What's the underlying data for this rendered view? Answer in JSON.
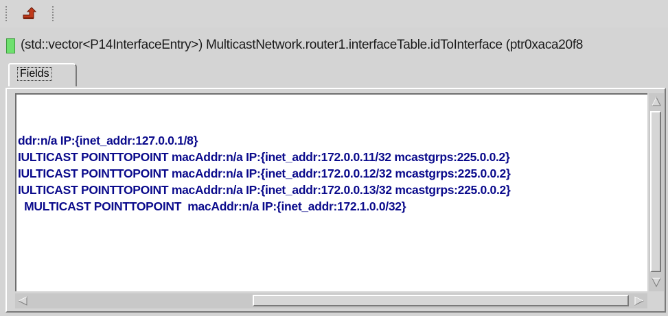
{
  "toolbar": {
    "buttons": [
      {
        "icon": "parent-object-arrow-icon"
      }
    ]
  },
  "infobar": {
    "status_color": "#6ee06e",
    "object_text": "(std::vector<P14InterfaceEntry>) MulticastNetwork.router1.interfaceTable.idToInterface  (ptr0xaca20f8"
  },
  "tabs": [
    {
      "label": "Fields"
    }
  ],
  "content": {
    "lines": [
      "ddr:n/a IP:{inet_addr:127.0.0.1/8}",
      "IULTICAST POINTTOPOINT  macAddr:n/a IP:{inet_addr:172.0.0.11/32 mcastgrps:225.0.0.2}",
      "IULTICAST POINTTOPOINT  macAddr:n/a IP:{inet_addr:172.0.0.12/32 mcastgrps:225.0.0.2}",
      "IULTICAST POINTTOPOINT  macAddr:n/a IP:{inet_addr:172.0.0.13/32 mcastgrps:225.0.0.2}",
      "  MULTICAST POINTTOPOINT  macAddr:n/a IP:{inet_addr:172.1.0.0/32}"
    ],
    "text_color": "#0b0b8c"
  }
}
